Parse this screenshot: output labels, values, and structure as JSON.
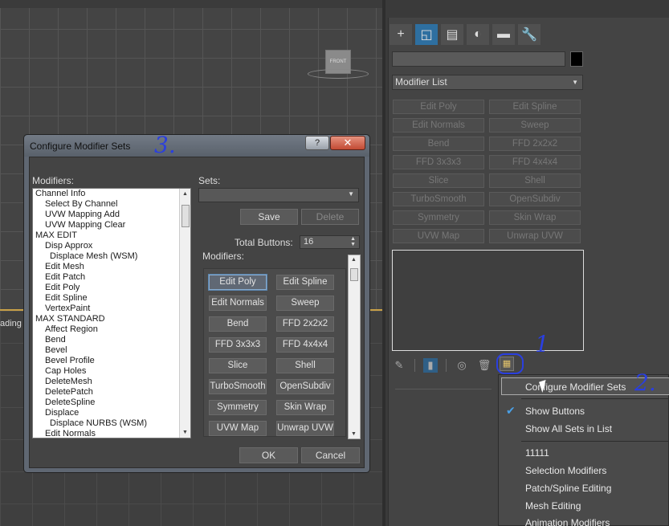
{
  "viewport": {
    "viewcube_label": "FRONT",
    "partial_text": "ading"
  },
  "command_panel": {
    "tabs": [
      "+",
      "◱",
      "▤",
      "◐",
      "▬",
      "🔧"
    ],
    "modifier_list_label": "Modifier List",
    "modifier_buttons": [
      "Edit Poly",
      "Edit Spline",
      "Edit Normals",
      "Sweep",
      "Bend",
      "FFD 2x2x2",
      "FFD 3x3x3",
      "FFD 4x4x4",
      "Slice",
      "Shell",
      "TurboSmooth",
      "OpenSubdiv",
      "Symmetry",
      "Skin Wrap",
      "UVW Map",
      "Unwrap UVW"
    ]
  },
  "context_menu": {
    "items": [
      "Configure Modifier Sets",
      "Show Buttons",
      "Show All Sets in List",
      "11111",
      "Selection Modifiers",
      "Patch/Spline Editing",
      "Mesh Editing",
      "Animation Modifiers"
    ],
    "checked_item": "Show Buttons"
  },
  "dialog": {
    "title": "Configure Modifier Sets",
    "help_label": "?",
    "close_label": "✕",
    "modifiers_label": "Modifiers:",
    "sets_label": "Sets:",
    "save_label": "Save",
    "delete_label": "Delete",
    "total_buttons_label": "Total Buttons:",
    "total_buttons_value": "16",
    "panel_modifiers_label": "Modifiers:",
    "ok_label": "OK",
    "cancel_label": "Cancel",
    "modifier_tree": [
      {
        "label": "Channel Info",
        "level": 0
      },
      {
        "label": "Select By Channel",
        "level": 1
      },
      {
        "label": "UVW Mapping Add",
        "level": 1
      },
      {
        "label": "UVW Mapping Clear",
        "level": 1
      },
      {
        "label": "MAX EDIT",
        "level": 0
      },
      {
        "label": "Disp Approx",
        "level": 1
      },
      {
        "label": "Displace Mesh (WSM)",
        "level": 2
      },
      {
        "label": "Edit Mesh",
        "level": 1
      },
      {
        "label": "Edit Patch",
        "level": 1
      },
      {
        "label": "Edit Poly",
        "level": 1
      },
      {
        "label": "Edit Spline",
        "level": 1
      },
      {
        "label": "VertexPaint",
        "level": 1
      },
      {
        "label": "MAX STANDARD",
        "level": 0
      },
      {
        "label": "Affect Region",
        "level": 1
      },
      {
        "label": "Bend",
        "level": 1
      },
      {
        "label": "Bevel",
        "level": 1
      },
      {
        "label": "Bevel Profile",
        "level": 1
      },
      {
        "label": "Cap Holes",
        "level": 1
      },
      {
        "label": "DeleteMesh",
        "level": 1
      },
      {
        "label": "DeletePatch",
        "level": 1
      },
      {
        "label": "DeleteSpline",
        "level": 1
      },
      {
        "label": "Displace",
        "level": 1
      },
      {
        "label": "Displace NURBS (WSM)",
        "level": 2
      },
      {
        "label": "Edit Normals",
        "level": 1
      }
    ],
    "set_buttons": [
      "Edit Poly",
      "Edit Spline",
      "Edit Normals",
      "Sweep",
      "Bend",
      "FFD 2x2x2",
      "FFD 3x3x3",
      "FFD 4x4x4",
      "Slice",
      "Shell",
      "TurboSmooth",
      "OpenSubdiv",
      "Symmetry",
      "Skin Wrap",
      "UVW Map",
      "Unwrap UVW"
    ],
    "selected_set_button": "Edit Poly"
  },
  "annotations": {
    "one": "1",
    "two": "2.",
    "three": "3."
  },
  "colors": {
    "accent": "#2e6fa0",
    "annotation": "#2a3fe0",
    "close_button": "#c24b34"
  }
}
